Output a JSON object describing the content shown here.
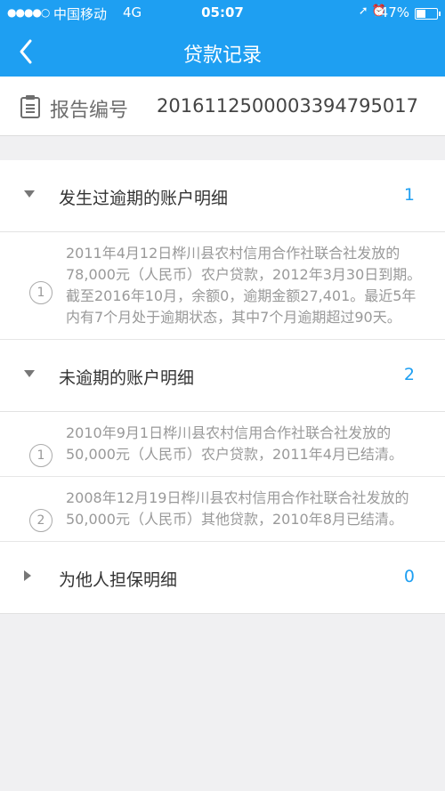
{
  "status_bar": {
    "signal": "●●●●○",
    "carrier": "中国移动",
    "network": "4G",
    "time": "05:07",
    "icons": "➚ ⏰",
    "battery": "47%"
  },
  "nav": {
    "title": "贷款记录"
  },
  "report": {
    "label": "报告编号",
    "value": "2016112500003394795017"
  },
  "sections": {
    "overdue": {
      "label": "发生过逾期的账户明细",
      "count": "1",
      "items": [
        {
          "num": "1",
          "text": "2011年4月12日桦川县农村信用合作社联合社发放的78,000元（人民币）农户贷款，2012年3月30日到期。截至2016年10月，余额0，逾期金额27,401。最近5年内有7个月处于逾期状态，其中7个月逾期超过90天。"
        }
      ]
    },
    "not_overdue": {
      "label": "未逾期的账户明细",
      "count": "2",
      "items": [
        {
          "num": "1",
          "text": "2010年9月1日桦川县农村信用合作社联合社发放的50,000元（人民币）农户贷款，2011年4月已结清。"
        },
        {
          "num": "2",
          "text": "2008年12月19日桦川县农村信用合作社联合社发放的50,000元（人民币）其他贷款，2010年8月已结清。"
        }
      ]
    },
    "guarantee": {
      "label": "为他人担保明细",
      "count": "0"
    }
  }
}
